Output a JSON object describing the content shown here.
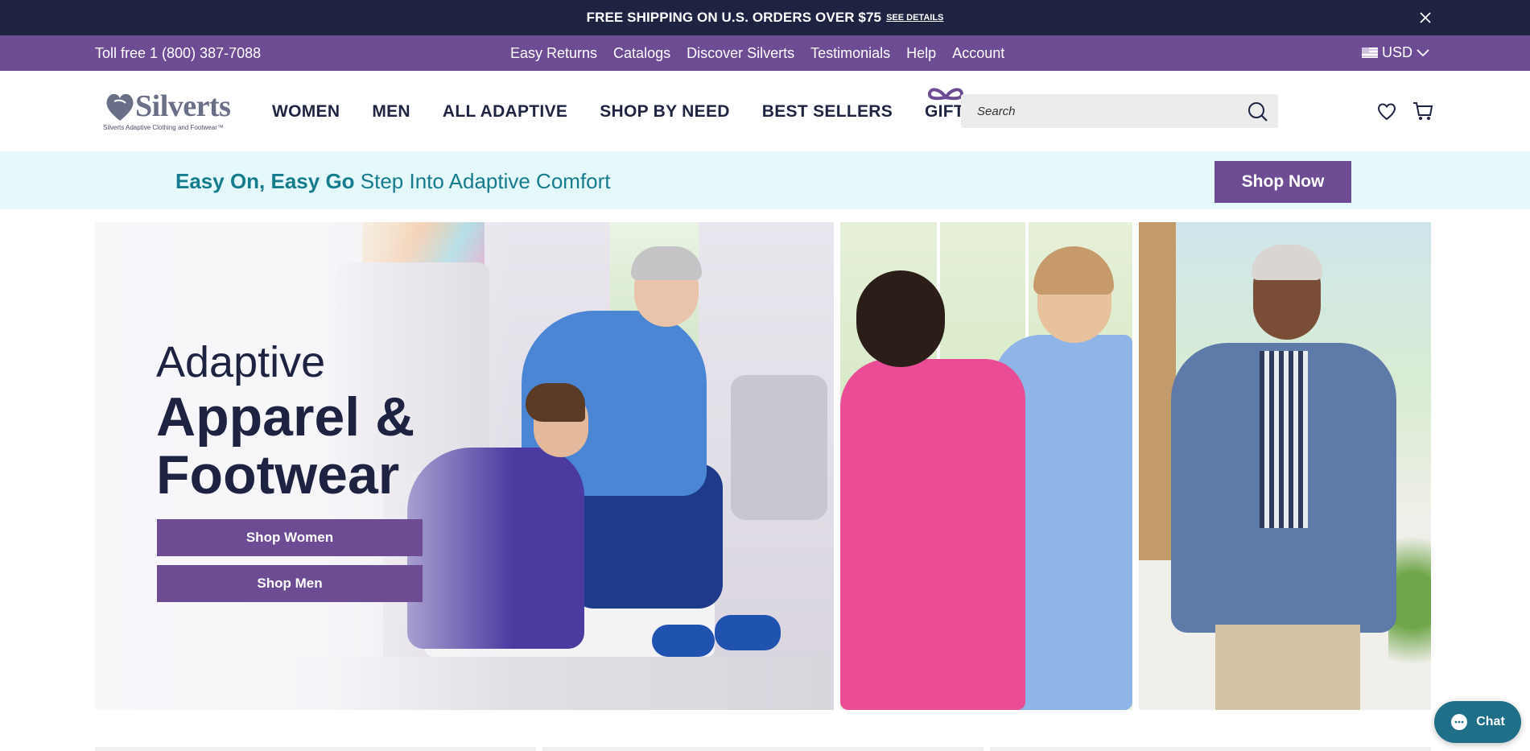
{
  "announcement": {
    "text": "FREE SHIPPING ON U.S. ORDERS OVER $75",
    "link_label": "SEE DETAILS",
    "close_icon": "close-icon"
  },
  "utility_bar": {
    "toll_free": "Toll free 1 (800) 387-7088",
    "links": [
      "Easy Returns",
      "Catalogs",
      "Discover Silverts",
      "Testimonials",
      "Help",
      "Account"
    ],
    "currency": "USD"
  },
  "header": {
    "logo_text": "Silverts",
    "logo_tagline": "Silverts Adaptive Clothing and Footwear™",
    "nav": [
      "WOMEN",
      "MEN",
      "ALL ADAPTIVE",
      "SHOP BY NEED",
      "BEST SELLERS",
      "GIFTS"
    ],
    "search_placeholder": "Search"
  },
  "promo": {
    "bold": "Easy On, Easy Go",
    "text": " Step Into Adaptive Comfort",
    "button": "Shop Now"
  },
  "hero": {
    "line1": "Adaptive",
    "line2": "Apparel &",
    "line3": "Footwear",
    "button_women": "Shop Women",
    "button_men": "Shop Men"
  },
  "chat": {
    "label": "Chat"
  },
  "colors": {
    "navy": "#1d2340",
    "purple": "#6d4c93",
    "teal": "#157c8e",
    "promo_bg": "#e5f8fa",
    "chat": "#1f6f88"
  }
}
